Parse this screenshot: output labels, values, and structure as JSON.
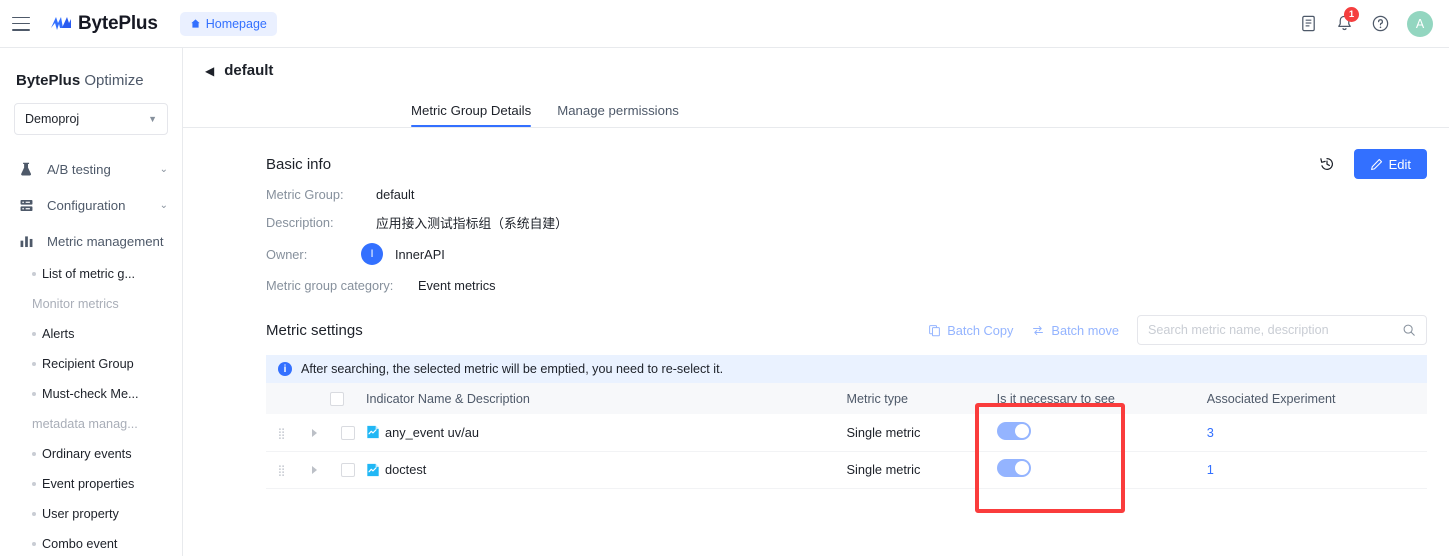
{
  "topbar": {
    "menu_icon": "hamburger-icon",
    "brand": "BytePlus",
    "homepage_label": "Homepage",
    "home_icon": "home-icon",
    "doc_icon": "document-icon",
    "bell_icon": "bell-icon",
    "notification_count": "1",
    "help_icon": "question-circle-icon",
    "avatar_initial": "A",
    "accent": "#3370ff",
    "badge_color": "#f53f3f",
    "avatar_color": "#93d6c0"
  },
  "sidebar": {
    "title_bold": "BytePlus",
    "title_rest": " Optimize",
    "project": {
      "value": "Demoproj",
      "caret": "caret-down-icon"
    },
    "groups": [
      {
        "label": "A/B testing",
        "icon": "flask-icon",
        "chevron": "chevron-down-icon"
      },
      {
        "label": "Configuration",
        "icon": "server-icon",
        "chevron": "chevron-down-icon"
      },
      {
        "label": "Metric management",
        "icon": "bar-chart-icon",
        "chevron": ""
      }
    ],
    "items": [
      {
        "type": "sub",
        "label": "List of metric g..."
      },
      {
        "type": "label",
        "label": "Monitor metrics"
      },
      {
        "type": "sub",
        "label": "Alerts"
      },
      {
        "type": "sub",
        "label": "Recipient Group"
      },
      {
        "type": "sub",
        "label": "Must-check Me..."
      },
      {
        "type": "label",
        "label": "metadata manag..."
      },
      {
        "type": "sub",
        "label": "Ordinary events"
      },
      {
        "type": "sub",
        "label": "Event properties"
      },
      {
        "type": "sub",
        "label": "User property"
      },
      {
        "type": "sub",
        "label": "Combo event"
      }
    ]
  },
  "page": {
    "back_icon": "back-arrow-icon",
    "title": "default",
    "tabs": [
      {
        "label": "Metric Group Details",
        "active": true
      },
      {
        "label": "Manage permissions",
        "active": false
      }
    ],
    "history_icon": "history-icon",
    "edit_label": "Edit",
    "edit_icon": "pencil-icon"
  },
  "basic_info": {
    "heading": "Basic info",
    "rows": [
      {
        "key": "Metric Group:",
        "value": "default"
      },
      {
        "key": "Description:",
        "value": "应用接入测试指标组（系统自建）"
      },
      {
        "key": "Owner:",
        "value": "InnerAPI",
        "avatar": "I"
      },
      {
        "key": "Metric group category:",
        "value": "Event metrics"
      }
    ]
  },
  "metric_settings": {
    "heading": "Metric settings",
    "batch_copy_label": "Batch Copy",
    "batch_copy_icon": "copy-icon",
    "batch_move_label": "Batch move",
    "batch_move_icon": "move-icon",
    "search_placeholder": "Search metric name, description",
    "search_value": "",
    "search_icon": "search-icon",
    "alert_icon": "info-icon",
    "alert_text": "After searching, the selected metric will be emptied, you need to re-select it.",
    "columns": [
      "Indicator Name & Description",
      "Metric type",
      "Is it necessary to see",
      "Associated Experiment"
    ],
    "rows": [
      {
        "drag": "drag-handle-icon",
        "expand": "expand-triangle-icon",
        "checked": false,
        "metric_icon": "metric-doc-icon",
        "name": "any_event uv/au",
        "type": "Single metric",
        "necessary": true,
        "experiments": "3"
      },
      {
        "drag": "drag-handle-icon",
        "expand": "expand-triangle-icon",
        "checked": false,
        "metric_icon": "metric-doc-icon",
        "name": "doctest",
        "type": "Single metric",
        "necessary": true,
        "experiments": "1"
      }
    ]
  },
  "highlight": {
    "color": "#fa3c3c",
    "target": "is-it-necessary-to-see-column"
  }
}
